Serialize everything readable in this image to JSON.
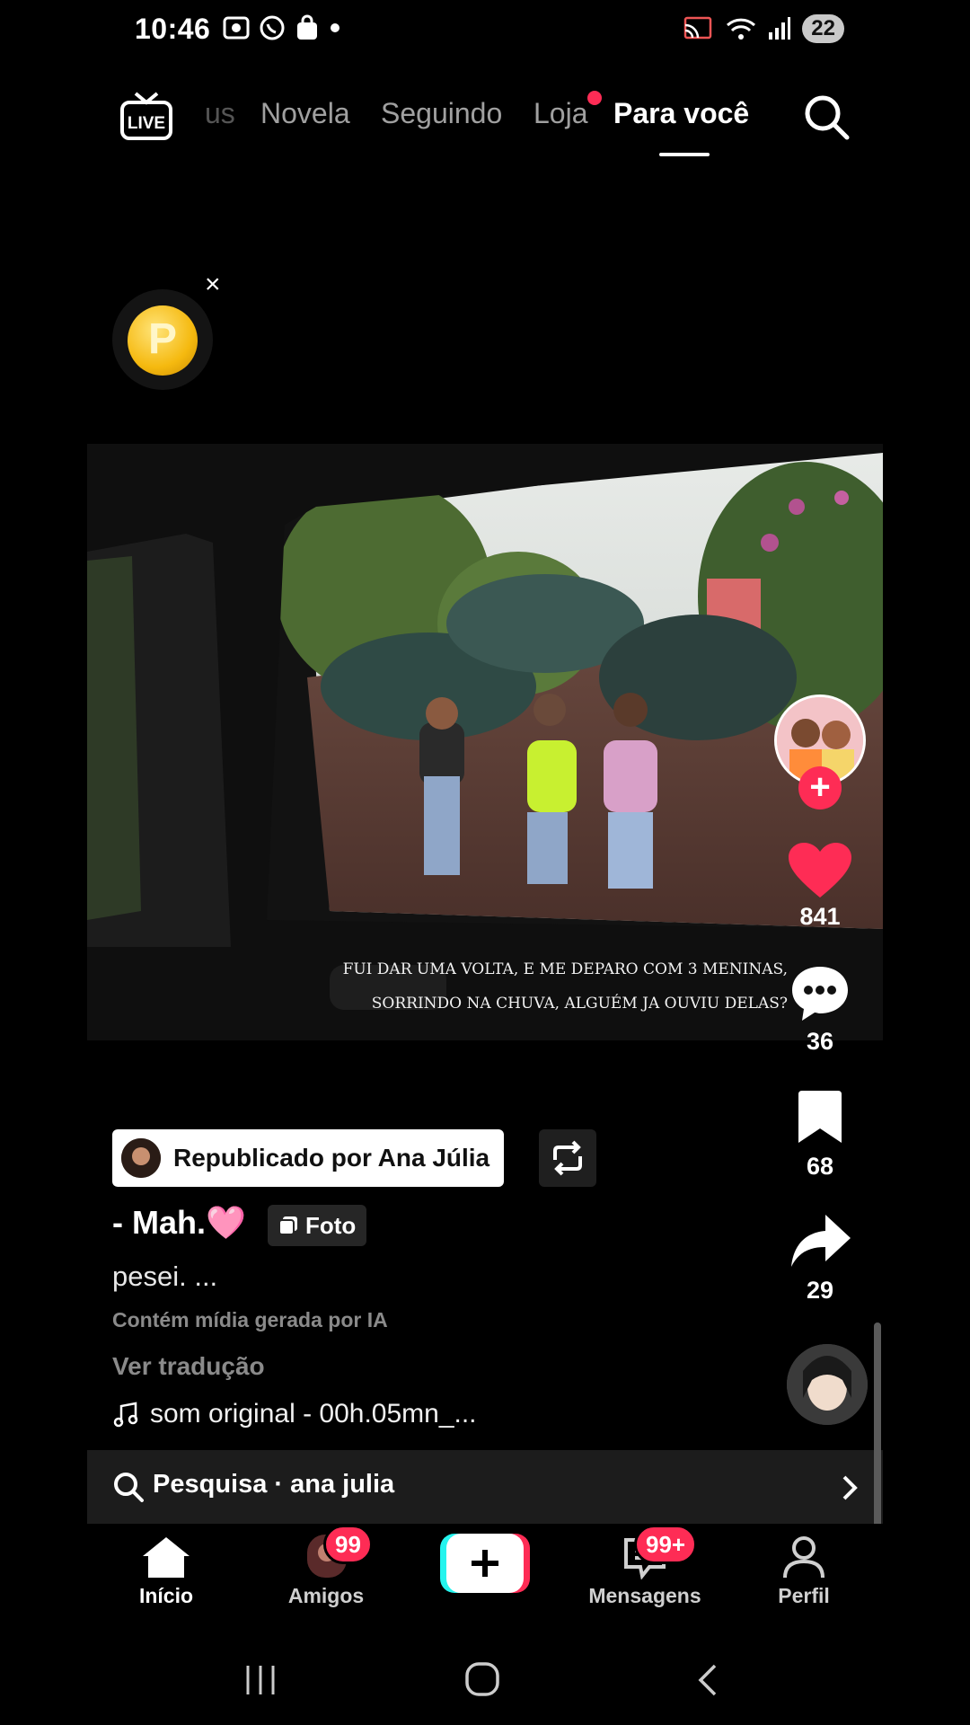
{
  "status_bar": {
    "time": "10:46",
    "battery": "22"
  },
  "top_nav": {
    "live_label": "LIVE",
    "tabs": [
      {
        "label": "us",
        "active": false
      },
      {
        "label": "Novela",
        "active": false
      },
      {
        "label": "Seguindo",
        "active": false
      },
      {
        "label": "Loja",
        "active": false,
        "dot": true
      },
      {
        "label": "Para você",
        "active": true
      }
    ]
  },
  "coin_widget": {
    "letter": "P",
    "close": "×"
  },
  "post": {
    "photo_caption_line1": "FUI DAR UMA VOLTA, E ME DEPARO COM 3 MENINAS,",
    "photo_caption_line2": "SORRINDO NA CHUVA, ALGUÉM JA OUVIU DELAS?",
    "likes": "841",
    "comments": "36",
    "saves": "68",
    "shares": "29",
    "repost_label": "Republicado por Ana Júlia",
    "author": "- Mah.🩷",
    "badge": "Foto",
    "description": "pesei. ...",
    "ai_note": "Contém mídia gerada por IA",
    "translate": "Ver tradução",
    "sound": "som original - 00h.05mn_..."
  },
  "search_suggestion": {
    "text": "Pesquisa · ana julia"
  },
  "bottom_nav": {
    "items": [
      {
        "label": "Início",
        "active": true
      },
      {
        "label": "Amigos",
        "badge": "99"
      },
      {
        "label": ""
      },
      {
        "label": "Mensagens",
        "badge": "99+"
      },
      {
        "label": "Perfil"
      }
    ]
  },
  "colors": {
    "accent": "#fe2c55",
    "background": "#000000"
  }
}
